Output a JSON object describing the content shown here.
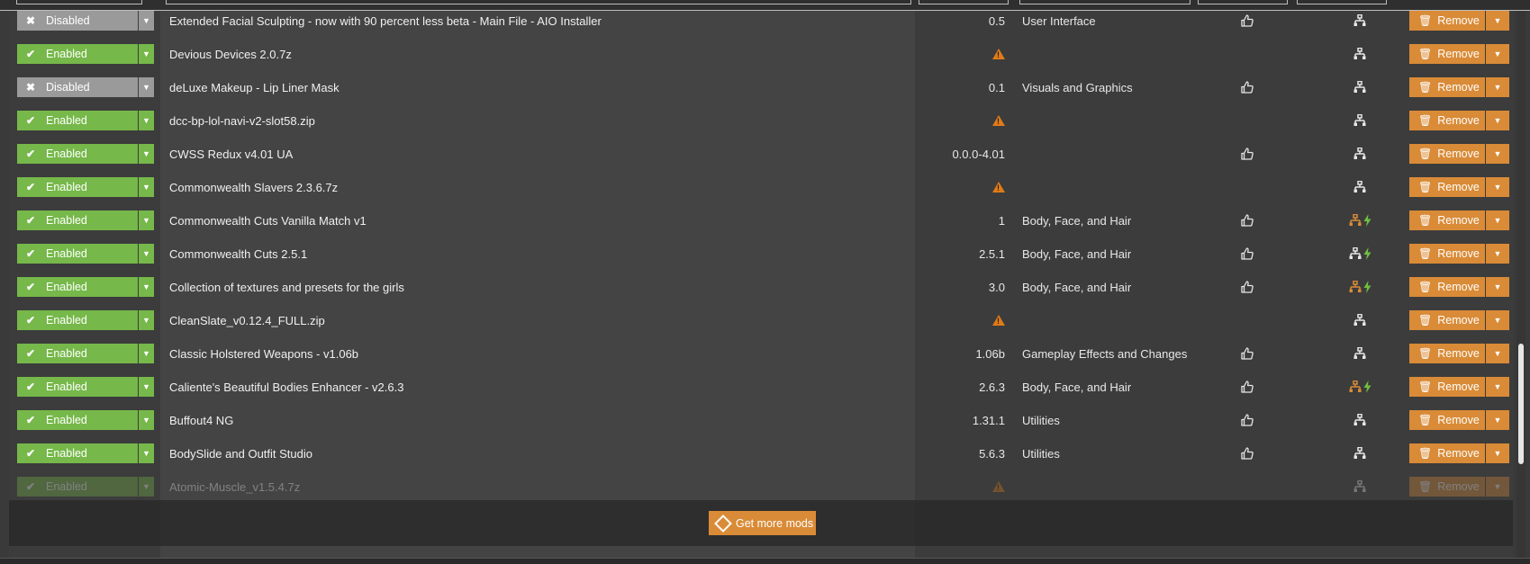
{
  "rows": [
    {
      "status": "Disabled",
      "status_icon": "x-icon",
      "name": "Extended Facial Sculpting - now with 90 percent less beta - Main File - AIO Installer",
      "version": "0.5",
      "warning": false,
      "category": "User Interface",
      "endorse": true,
      "deps": "plain"
    },
    {
      "status": "Enabled",
      "status_icon": "check-icon",
      "name": "Devious Devices 2.0.7z",
      "version": "",
      "warning": true,
      "category": "",
      "endorse": false,
      "deps": "plain"
    },
    {
      "status": "Disabled",
      "status_icon": "x-icon",
      "name": "deLuxe Makeup - Lip Liner Mask",
      "version": "0.1",
      "warning": false,
      "category": "Visuals and Graphics",
      "endorse": true,
      "deps": "plain"
    },
    {
      "status": "Enabled",
      "status_icon": "check-icon",
      "name": "dcc-bp-lol-navi-v2-slot58.zip",
      "version": "",
      "warning": true,
      "category": "",
      "endorse": false,
      "deps": "plain"
    },
    {
      "status": "Enabled",
      "status_icon": "check-icon",
      "name": "CWSS Redux v4.01 UA",
      "version": "0.0.0-4.01",
      "warning": false,
      "category": "",
      "endorse": true,
      "deps": "plain"
    },
    {
      "status": "Enabled",
      "status_icon": "check-icon",
      "name": "Commonwealth Slavers 2.3.6.7z",
      "version": "",
      "warning": true,
      "category": "",
      "endorse": false,
      "deps": "plain"
    },
    {
      "status": "Enabled",
      "status_icon": "check-icon",
      "name": "Commonwealth Cuts Vanilla Match v1",
      "version": "1",
      "warning": false,
      "category": "Body, Face, and Hair",
      "endorse": true,
      "deps": "orange-bolt"
    },
    {
      "status": "Enabled",
      "status_icon": "check-icon",
      "name": "Commonwealth Cuts 2.5.1",
      "version": "2.5.1",
      "warning": false,
      "category": "Body, Face, and Hair",
      "endorse": true,
      "deps": "plain-bolt"
    },
    {
      "status": "Enabled",
      "status_icon": "check-icon",
      "name": "Collection of textures and presets for the girls",
      "version": "3.0",
      "warning": false,
      "category": "Body, Face, and Hair",
      "endorse": true,
      "deps": "orange-bolt"
    },
    {
      "status": "Enabled",
      "status_icon": "check-icon",
      "name": "CleanSlate_v0.12.4_FULL.zip",
      "version": "",
      "warning": true,
      "category": "",
      "endorse": false,
      "deps": "plain"
    },
    {
      "status": "Enabled",
      "status_icon": "check-icon",
      "name": "Classic Holstered Weapons - v1.06b",
      "version": "1.06b",
      "warning": false,
      "category": "Gameplay Effects and Changes",
      "endorse": true,
      "deps": "plain"
    },
    {
      "status": "Enabled",
      "status_icon": "check-icon",
      "name": "Caliente's Beautiful Bodies Enhancer - v2.6.3",
      "version": "2.6.3",
      "warning": false,
      "category": "Body, Face, and Hair",
      "endorse": true,
      "deps": "orange-bolt"
    },
    {
      "status": "Enabled",
      "status_icon": "check-icon",
      "name": "Buffout4 NG",
      "version": "1.31.1",
      "warning": false,
      "category": "Utilities",
      "endorse": true,
      "deps": "plain"
    },
    {
      "status": "Enabled",
      "status_icon": "check-icon",
      "name": "BodySlide and Outfit Studio",
      "version": "5.6.3",
      "warning": false,
      "category": "Utilities",
      "endorse": true,
      "deps": "plain"
    },
    {
      "status": "Enabled",
      "status_icon": "check-icon",
      "name": "Atomic-Muscle_v1.5.4.7z",
      "version": "",
      "warning": true,
      "category": "",
      "endorse": false,
      "deps": "plain"
    }
  ],
  "remove_label": "Remove",
  "get_more_label": "Get more mods",
  "colors": {
    "enabled": "#76b84a",
    "disabled": "#9a9a9a",
    "accent": "#d98b37",
    "warning": "#e07b18",
    "bolt": "#6fbf3f"
  }
}
